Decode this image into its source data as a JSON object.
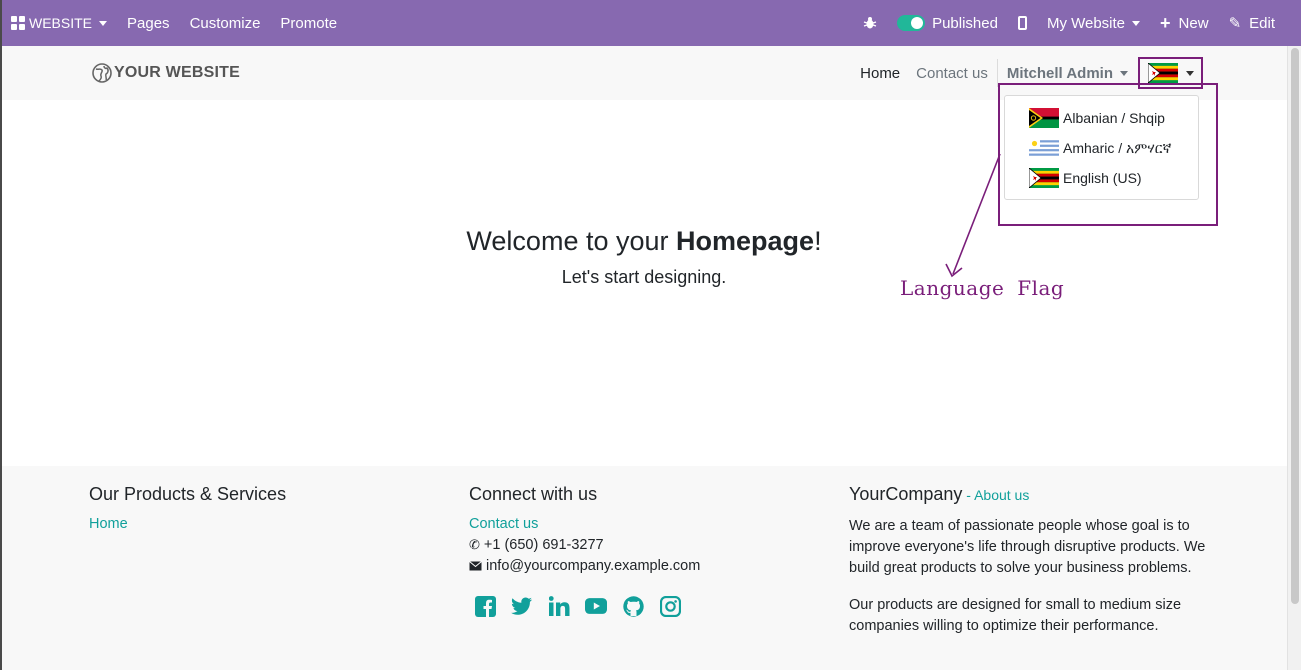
{
  "admin_bar": {
    "brand": "WEBSITE",
    "items": [
      "Pages",
      "Customize",
      "Promote"
    ],
    "published_label": "Published",
    "website_selector": "My Website",
    "new_label": "New",
    "edit_label": "Edit",
    "color": "#8769b0"
  },
  "header": {
    "logo_text": "YOUR WEBSITE",
    "menu": [
      "Home",
      "Contact us"
    ],
    "user": "Mitchell Admin"
  },
  "language_dropdown": {
    "items": [
      {
        "label": "Albanian / Shqip"
      },
      {
        "label": "Amharic / አምሃርኛ"
      },
      {
        "label": "English (US)"
      }
    ]
  },
  "annotation": {
    "label": "Language Flag",
    "color": "#7a1e7a"
  },
  "hero": {
    "title_prefix": "Welcome to your ",
    "title_bold": "Homepage",
    "title_suffix": "!",
    "subtitle": "Let's start designing."
  },
  "footer": {
    "col1": {
      "title": "Our Products & Services",
      "link": "Home"
    },
    "col2": {
      "title": "Connect with us",
      "link": "Contact us",
      "phone": "+1 (650) 691-3277",
      "email": "info@yourcompany.example.com",
      "social_icons": [
        "facebook-icon",
        "twitter-icon",
        "linkedin-icon",
        "youtube-icon",
        "github-icon",
        "instagram-icon"
      ]
    },
    "col3": {
      "title": "YourCompany",
      "title_sep": " - ",
      "title_link": "About us",
      "p1": "We are a team of passionate people whose goal is to improve everyone's life through disruptive products. We build great products to solve your business problems.",
      "p2": "Our products are designed for small to medium size companies willing to optimize their performance."
    },
    "link_color": "#11a09b"
  }
}
